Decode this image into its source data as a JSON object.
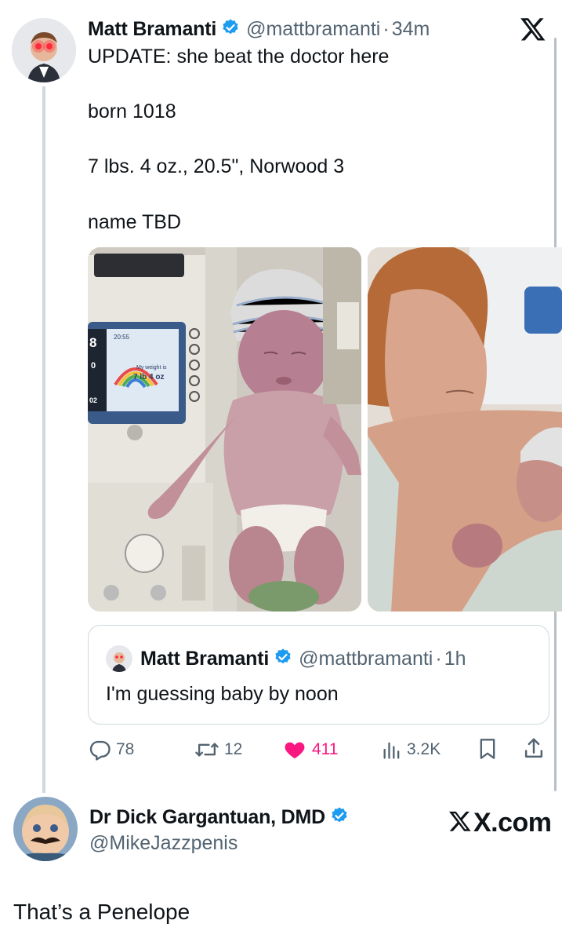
{
  "main_tweet": {
    "author_name": "Matt Bramanti",
    "handle": "@mattbramanti",
    "separator": "·",
    "time": "34m",
    "text_lines": [
      "UPDATE: she beat the doctor here",
      "born 1018",
      "7 lbs. 4 oz., 20.5\", Norwood 3",
      "name TBD"
    ],
    "media": {
      "left_photo_label": "baby-on-scale-photo",
      "left_screen": {
        "time": "20:55",
        "weight_caption": "My weight is",
        "weight_value": "7 lb 4 oz",
        "digit": "8",
        "side_values": [
          "0",
          "02"
        ]
      },
      "right_photo_label": "mother-holding-baby-photo"
    },
    "quoted_tweet": {
      "author_name": "Matt Bramanti",
      "handle": "@mattbramanti",
      "separator": "·",
      "time": "1h",
      "text": "I'm guessing baby by noon"
    },
    "actions": {
      "replies": "78",
      "retweets": "12",
      "likes": "411",
      "views": "3.2K"
    },
    "colors": {
      "like": "#f91880",
      "verified": "#1d9bf0",
      "secondary_text": "#536471"
    }
  },
  "reply_tweet": {
    "author_name": "Dr Dick Gargantuan, DMD",
    "handle": "@MikeJazzpenis",
    "text": "That’s a Penelope"
  },
  "watermark": {
    "logo_icon": "x-logo-icon",
    "site_text": "X.com"
  }
}
